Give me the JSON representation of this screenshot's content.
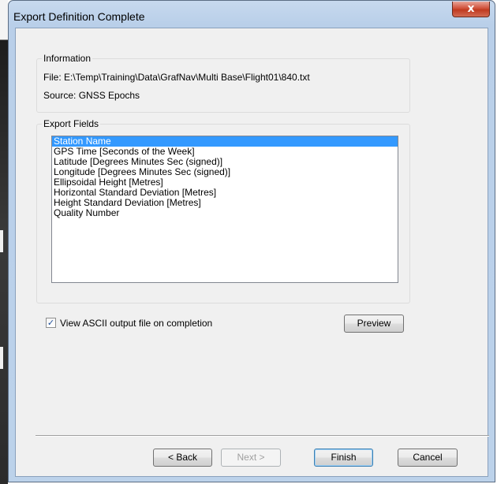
{
  "window": {
    "title": "Export Definition Complete",
    "close_glyph": "x"
  },
  "information": {
    "group_label": "Information",
    "file_line": "File: E:\\Temp\\Training\\Data\\GrafNav\\Multi Base\\Flight01\\840.txt",
    "source_line": "Source: GNSS Epochs"
  },
  "export_fields": {
    "group_label": "Export Fields",
    "items": [
      "Station Name",
      "GPS Time [Seconds of the Week]",
      "Latitude [Degrees Minutes Sec (signed)]",
      "Longitude [Degrees Minutes Sec (signed)]",
      "Ellipsoidal Height [Metres]",
      "Horizontal Standard Deviation [Metres]",
      "Height Standard Deviation [Metres]",
      "Quality Number"
    ],
    "selected_item": "Station Name"
  },
  "options": {
    "view_ascii_label": "View ASCII output file on completion",
    "view_ascii_checked": true,
    "check_glyph": "✓",
    "preview_label": "Preview"
  },
  "footer": {
    "back_label": "< Back",
    "next_label": "Next >",
    "finish_label": "Finish",
    "cancel_label": "Cancel"
  },
  "colors": {
    "selection": "#3399ff",
    "close_button": "#c8452b",
    "titlebar": "#c2d6ec"
  },
  "icons": {
    "close": "close-icon",
    "checkbox_check": "check-icon"
  }
}
